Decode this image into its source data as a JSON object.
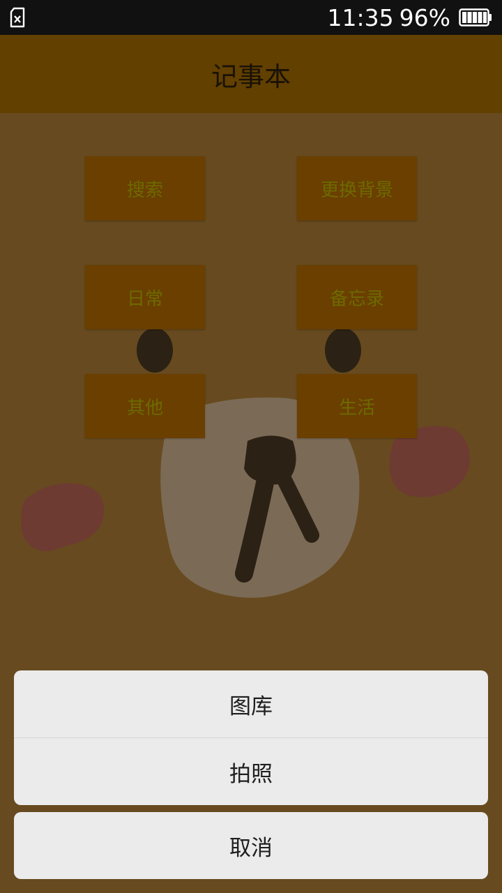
{
  "status_bar": {
    "time": "11:35",
    "battery_percent": "96%",
    "sim_icon": "no-sim-icon",
    "battery_icon": "battery-full-icon"
  },
  "app_bar": {
    "title": "记事本"
  },
  "categories": [
    {
      "label": "搜索"
    },
    {
      "label": "更换背景"
    },
    {
      "label": "日常"
    },
    {
      "label": "备忘录"
    },
    {
      "label": "其他"
    },
    {
      "label": "生活"
    }
  ],
  "action_sheet": {
    "gallery_label": "图库",
    "camera_label": "拍照",
    "cancel_label": "取消"
  },
  "colors": {
    "status_bar_bg": "#111111",
    "app_bar_bg": "#624000",
    "content_bg": "#674a1f",
    "button_bg": "#6a3f00",
    "button_text": "#6d6a00",
    "sheet_bg": "#ebebeb"
  }
}
